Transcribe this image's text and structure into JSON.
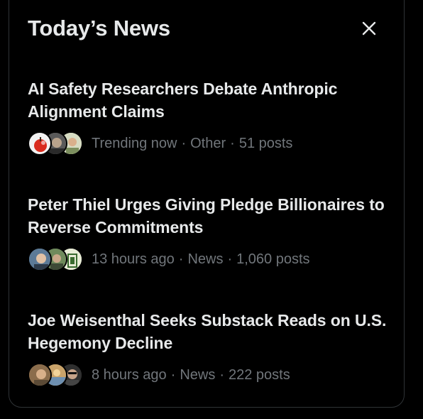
{
  "header": {
    "title": "Today’s News",
    "close_icon": "close-icon"
  },
  "stories": [
    {
      "title": "AI Safety Researchers Debate Anthropic Alignment Claims",
      "time": "Trending now",
      "category": "Other",
      "posts": "51 posts"
    },
    {
      "title": "Peter Thiel Urges Giving Pledge Billionaires to Reverse Commitments",
      "time": "13 hours ago",
      "category": "News",
      "posts": "1,060 posts"
    },
    {
      "title": "Joe Weisenthal Seeks Substack Reads on U.S. Hegemony Decline",
      "time": "8 hours ago",
      "category": "News",
      "posts": "222 posts"
    }
  ],
  "separator": "·",
  "colors": {
    "background": "#000000",
    "title_text": "#e7e9ea",
    "meta_text": "#71767b",
    "border": "#2f3336"
  }
}
